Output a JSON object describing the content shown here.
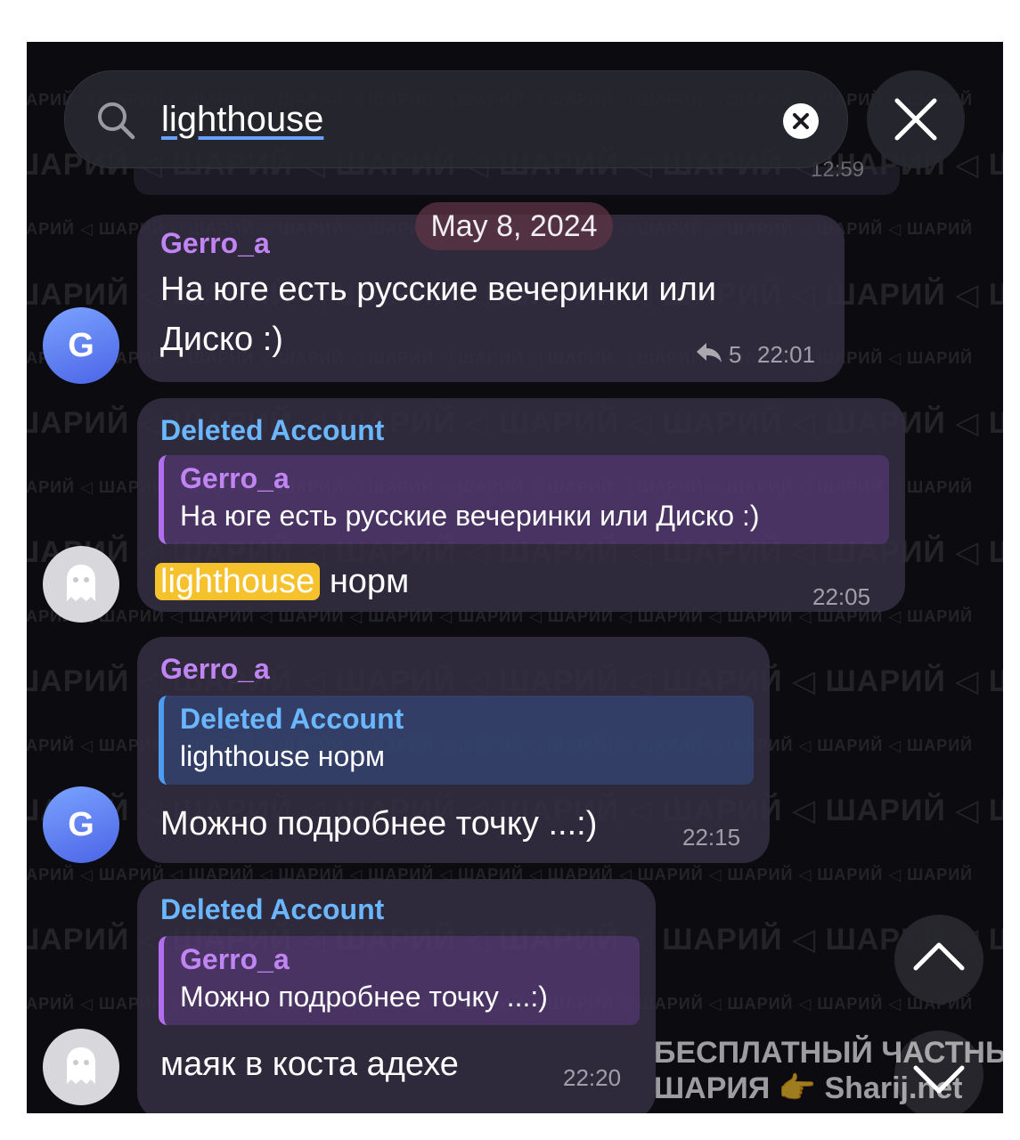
{
  "search": {
    "query": "lighthouse",
    "ghost_time": "12:59"
  },
  "date_separator": "May 8, 2024",
  "watermark": {
    "big": "ШАРИЙ ◁ ШАРИЙ ◁ ШАРИЙ ◁ ШАРИЙ ◁ ШАРИЙ ◁ ШАРИЙ ◁ ШАРИЙ",
    "small": "ШАРИЙ ◁ ШАРИЙ ◁ ШАРИЙ ◁ ШАРИЙ ◁ ШАРИЙ ◁ ШАРИЙ ◁ ШАРИЙ ◁ ШАРИЙ ◁ ШАРИЙ ◁ ШАРИЙ ◁ ШАРИЙ",
    "footer_line1": "БЕСПЛАТНЫЙ ЧАСТНЫЙ",
    "footer_line2": "ШАРИЯ 👉 Sharij.net"
  },
  "messages": [
    {
      "sender": "Gerro_a",
      "avatar_letter": "G",
      "text_line1": "На юге есть русские вечеринки или",
      "text_line2": "Диско :)",
      "replies_count": "5",
      "time": "22:01"
    },
    {
      "sender": "Deleted Account",
      "reply_name": "Gerro_a",
      "reply_text": "На юге есть русские вечеринки или Диско :)",
      "highlight": "lighthouse",
      "text_rest": "норм",
      "time": "22:05"
    },
    {
      "sender": "Gerro_a",
      "avatar_letter": "G",
      "reply_name": "Deleted Account",
      "reply_text": "lighthouse норм",
      "text": "Можно подробнее точку ...:)",
      "time": "22:15"
    },
    {
      "sender": "Deleted Account",
      "reply_name": "Gerro_a",
      "reply_text": "Можно подробнее точку ...:)",
      "text": "маяк в коста адехе",
      "time": "22:20"
    }
  ]
}
